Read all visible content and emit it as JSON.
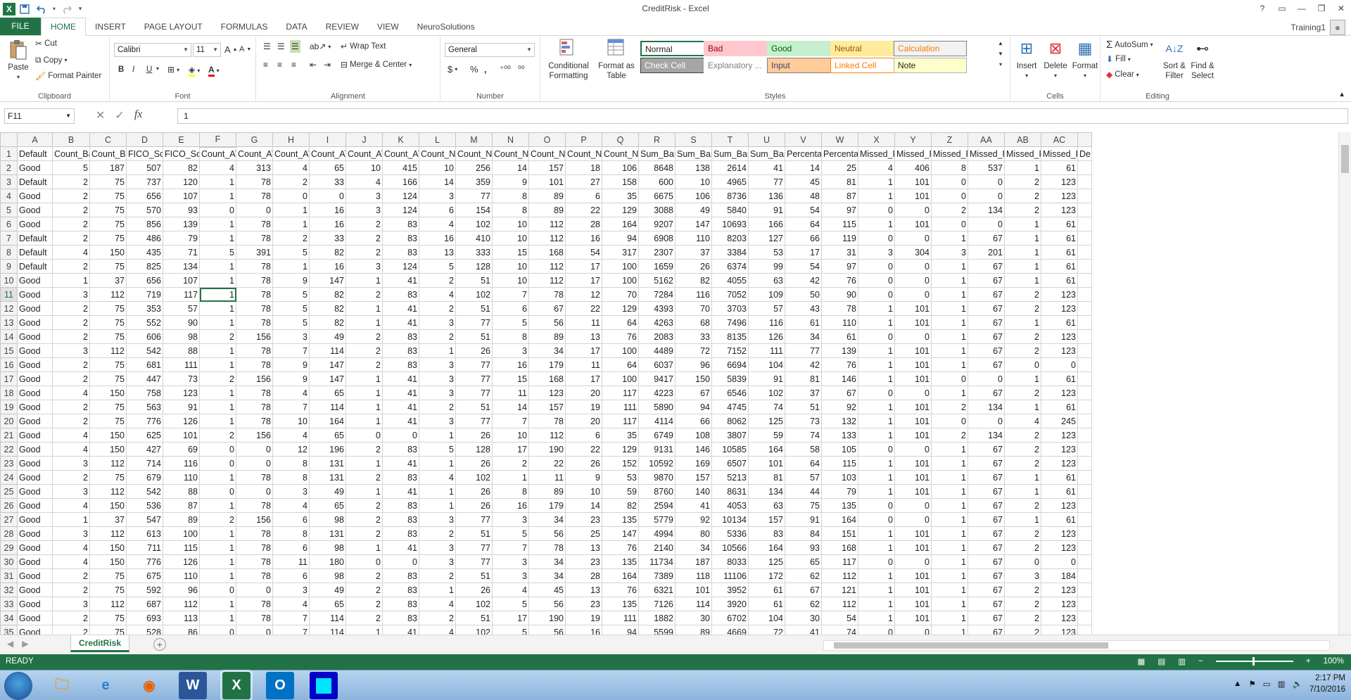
{
  "window": {
    "title": "CreditRisk - Excel",
    "help": "?",
    "restore_ribbon": "▭",
    "minimize": "—",
    "maximize": "❐",
    "close": "✕"
  },
  "qat": {
    "excel_logo": "X",
    "save_icon": "save-icon",
    "undo_icon": "undo-icon",
    "redo_icon": "redo-icon",
    "customize": "▾"
  },
  "tabs": [
    "FILE",
    "HOME",
    "INSERT",
    "PAGE LAYOUT",
    "FORMULAS",
    "DATA",
    "REVIEW",
    "VIEW",
    "NeuroSolutions"
  ],
  "user": {
    "name": "Training1"
  },
  "ribbon": {
    "clipboard": {
      "label": "Clipboard",
      "paste": "Paste",
      "cut": "Cut",
      "copy": "Copy",
      "format_painter": "Format Painter"
    },
    "font": {
      "label": "Font",
      "font_name": "Calibri",
      "font_size": "11",
      "bold": "B",
      "italic": "I",
      "underline": "U",
      "grow": "A",
      "shrink": "A"
    },
    "alignment": {
      "label": "Alignment",
      "wrap_text": "Wrap Text",
      "merge_center": "Merge & Center"
    },
    "number": {
      "label": "Number",
      "format": "General",
      "currency": "$",
      "percent": "%",
      "comma": ","
    },
    "styles": {
      "label": "Styles",
      "conditional_formatting": "Conditional\nFormatting",
      "format_as_table": "Format as\nTable",
      "cells": [
        {
          "text": "Normal",
          "bg": "#ffffff",
          "fg": "#222222",
          "border": "#217346"
        },
        {
          "text": "Bad",
          "bg": "#ffc7ce",
          "fg": "#9c0006",
          "border": "#ffc7ce"
        },
        {
          "text": "Good",
          "bg": "#c6efce",
          "fg": "#006100",
          "border": "#c6efce"
        },
        {
          "text": "Neutral",
          "bg": "#ffeb9c",
          "fg": "#9c5700",
          "border": "#ffeb9c"
        },
        {
          "text": "Calculation",
          "bg": "#f2f2f2",
          "fg": "#fa7d00",
          "border": "#7f7f7f"
        },
        {
          "text": "Check Cell",
          "bg": "#a5a5a5",
          "fg": "#ffffff",
          "border": "#3f3f3f"
        },
        {
          "text": "Explanatory ...",
          "bg": "#ffffff",
          "fg": "#7f7f7f",
          "border": "#ffffff"
        },
        {
          "text": "Input",
          "bg": "#ffcc99",
          "fg": "#3f3f76",
          "border": "#7f7f7f"
        },
        {
          "text": "Linked Cell",
          "bg": "#ffffff",
          "fg": "#fa7d00",
          "border": "#ff8001"
        },
        {
          "text": "Note",
          "bg": "#ffffcc",
          "fg": "#222222",
          "border": "#b2b2b2"
        }
      ]
    },
    "cells": {
      "label": "Cells",
      "insert": "Insert",
      "delete": "Delete",
      "format": "Format"
    },
    "editing": {
      "label": "Editing",
      "autosum": "AutoSum",
      "fill": "Fill",
      "clear": "Clear",
      "sort_filter": "Sort &\nFilter",
      "find_select": "Find &\nSelect"
    }
  },
  "formula_bar": {
    "name_box": "F11",
    "fx": "fx",
    "value": "1",
    "cancel": "✕",
    "enter": "✓"
  },
  "grid": {
    "col_letters": [
      "A",
      "B",
      "C",
      "D",
      "E",
      "F",
      "G",
      "H",
      "I",
      "J",
      "K",
      "L",
      "M",
      "N",
      "O",
      "P",
      "Q",
      "R",
      "S",
      "T",
      "U",
      "V",
      "W",
      "X",
      "Y",
      "Z",
      "AA",
      "AB",
      "AC"
    ],
    "header_row": [
      "Default",
      "Count_Ba",
      "Count_Ba",
      "FICO_Scor",
      "FICO_Scor",
      "Count_AT",
      "Count_AT",
      "Count_AT",
      "Count_AT",
      "Count_AT",
      "Count_AT",
      "Count_Ne",
      "Count_Ne",
      "Count_Ne",
      "Count_Ne",
      "Count_Ne",
      "Count_Ne",
      "Sum_Bank",
      "Sum_Bank",
      "Sum_Bank",
      "Sum_Bank",
      "Percentag",
      "Percentag",
      "Missed_P",
      "Missed_P",
      "Missed_P",
      "Missed_P",
      "Missed_P",
      "Missed_P"
    ],
    "last_col_fragment": "De",
    "rows": [
      [
        "Good",
        5,
        187,
        507,
        82,
        4,
        313,
        4,
        65,
        10,
        415,
        10,
        256,
        14,
        157,
        18,
        106,
        8648,
        138,
        2614,
        41,
        14,
        25,
        4,
        406,
        8,
        537,
        1,
        61
      ],
      [
        "Default",
        2,
        75,
        737,
        120,
        1,
        78,
        2,
        33,
        4,
        166,
        14,
        359,
        9,
        101,
        27,
        158,
        600,
        10,
        4965,
        77,
        45,
        81,
        1,
        101,
        0,
        0,
        2,
        123
      ],
      [
        "Good",
        2,
        75,
        656,
        107,
        1,
        78,
        0,
        0,
        3,
        124,
        3,
        77,
        8,
        89,
        6,
        35,
        6675,
        106,
        8736,
        136,
        48,
        87,
        1,
        101,
        0,
        0,
        2,
        123
      ],
      [
        "Good",
        2,
        75,
        570,
        93,
        0,
        0,
        1,
        16,
        3,
        124,
        6,
        154,
        8,
        89,
        22,
        129,
        3088,
        49,
        5840,
        91,
        54,
        97,
        0,
        0,
        2,
        134,
        2,
        123
      ],
      [
        "Good",
        2,
        75,
        856,
        139,
        1,
        78,
        1,
        16,
        2,
        83,
        4,
        102,
        10,
        112,
        28,
        164,
        9207,
        147,
        10693,
        166,
        64,
        115,
        1,
        101,
        0,
        0,
        1,
        61
      ],
      [
        "Default",
        2,
        75,
        486,
        79,
        1,
        78,
        2,
        33,
        2,
        83,
        16,
        410,
        10,
        112,
        16,
        94,
        6908,
        110,
        8203,
        127,
        66,
        119,
        0,
        0,
        1,
        67,
        1,
        61
      ],
      [
        "Default",
        4,
        150,
        435,
        71,
        5,
        391,
        5,
        82,
        2,
        83,
        13,
        333,
        15,
        168,
        54,
        317,
        2307,
        37,
        3384,
        53,
        17,
        31,
        3,
        304,
        3,
        201,
        1,
        61
      ],
      [
        "Default",
        2,
        75,
        825,
        134,
        1,
        78,
        1,
        16,
        3,
        124,
        5,
        128,
        10,
        112,
        17,
        100,
        1659,
        26,
        6374,
        99,
        54,
        97,
        0,
        0,
        1,
        67,
        1,
        61
      ],
      [
        "Good",
        1,
        37,
        656,
        107,
        1,
        78,
        9,
        147,
        1,
        41,
        2,
        51,
        10,
        112,
        17,
        100,
        5162,
        82,
        4055,
        63,
        42,
        76,
        0,
        0,
        1,
        67,
        1,
        61
      ],
      [
        "Good",
        3,
        112,
        719,
        117,
        1,
        78,
        5,
        82,
        2,
        83,
        4,
        102,
        7,
        78,
        12,
        70,
        7284,
        116,
        7052,
        109,
        50,
        90,
        0,
        0,
        1,
        67,
        2,
        123
      ],
      [
        "Good",
        2,
        75,
        353,
        57,
        1,
        78,
        5,
        82,
        1,
        41,
        2,
        51,
        6,
        67,
        22,
        129,
        4393,
        70,
        3703,
        57,
        43,
        78,
        1,
        101,
        1,
        67,
        2,
        123
      ],
      [
        "Good",
        2,
        75,
        552,
        90,
        1,
        78,
        5,
        82,
        1,
        41,
        3,
        77,
        5,
        56,
        11,
        64,
        4263,
        68,
        7496,
        116,
        61,
        110,
        1,
        101,
        1,
        67,
        1,
        61
      ],
      [
        "Good",
        2,
        75,
        606,
        98,
        2,
        156,
        3,
        49,
        2,
        83,
        2,
        51,
        8,
        89,
        13,
        76,
        2083,
        33,
        8135,
        126,
        34,
        61,
        0,
        0,
        1,
        67,
        2,
        123
      ],
      [
        "Good",
        3,
        112,
        542,
        88,
        1,
        78,
        7,
        114,
        2,
        83,
        1,
        26,
        3,
        34,
        17,
        100,
        4489,
        72,
        7152,
        111,
        77,
        139,
        1,
        101,
        1,
        67,
        2,
        123
      ],
      [
        "Good",
        2,
        75,
        681,
        111,
        1,
        78,
        9,
        147,
        2,
        83,
        3,
        77,
        16,
        179,
        11,
        64,
        6037,
        96,
        6694,
        104,
        42,
        76,
        1,
        101,
        1,
        67,
        0,
        0
      ],
      [
        "Good",
        2,
        75,
        447,
        73,
        2,
        156,
        9,
        147,
        1,
        41,
        3,
        77,
        15,
        168,
        17,
        100,
        9417,
        150,
        5839,
        91,
        81,
        146,
        1,
        101,
        0,
        0,
        1,
        61
      ],
      [
        "Good",
        4,
        150,
        758,
        123,
        1,
        78,
        4,
        65,
        1,
        41,
        3,
        77,
        11,
        123,
        20,
        117,
        4223,
        67,
        6546,
        102,
        37,
        67,
        0,
        0,
        1,
        67,
        2,
        123
      ],
      [
        "Good",
        2,
        75,
        563,
        91,
        1,
        78,
        7,
        114,
        1,
        41,
        2,
        51,
        14,
        157,
        19,
        111,
        5890,
        94,
        4745,
        74,
        51,
        92,
        1,
        101,
        2,
        134,
        1,
        61
      ],
      [
        "Good",
        2,
        75,
        776,
        126,
        1,
        78,
        10,
        164,
        1,
        41,
        3,
        77,
        7,
        78,
        20,
        117,
        4114,
        66,
        8062,
        125,
        73,
        132,
        1,
        101,
        0,
        0,
        4,
        245
      ],
      [
        "Good",
        4,
        150,
        625,
        101,
        2,
        156,
        4,
        65,
        0,
        0,
        1,
        26,
        10,
        112,
        6,
        35,
        6749,
        108,
        3807,
        59,
        74,
        133,
        1,
        101,
        2,
        134,
        2,
        123
      ],
      [
        "Good",
        4,
        150,
        427,
        69,
        0,
        0,
        12,
        196,
        2,
        83,
        5,
        128,
        17,
        190,
        22,
        129,
        9131,
        146,
        10585,
        164,
        58,
        105,
        0,
        0,
        1,
        67,
        2,
        123
      ],
      [
        "Good",
        3,
        112,
        714,
        116,
        0,
        0,
        8,
        131,
        1,
        41,
        1,
        26,
        2,
        22,
        26,
        152,
        10592,
        169,
        6507,
        101,
        64,
        115,
        1,
        101,
        1,
        67,
        2,
        123
      ],
      [
        "Good",
        2,
        75,
        679,
        110,
        1,
        78,
        8,
        131,
        2,
        83,
        4,
        102,
        1,
        11,
        9,
        53,
        9870,
        157,
        5213,
        81,
        57,
        103,
        1,
        101,
        1,
        67,
        1,
        61
      ],
      [
        "Good",
        3,
        112,
        542,
        88,
        0,
        0,
        3,
        49,
        1,
        41,
        1,
        26,
        8,
        89,
        10,
        59,
        8760,
        140,
        8631,
        134,
        44,
        79,
        1,
        101,
        1,
        67,
        1,
        61
      ],
      [
        "Good",
        4,
        150,
        536,
        87,
        1,
        78,
        4,
        65,
        2,
        83,
        1,
        26,
        16,
        179,
        14,
        82,
        2594,
        41,
        4053,
        63,
        75,
        135,
        0,
        0,
        1,
        67,
        2,
        123
      ],
      [
        "Good",
        1,
        37,
        547,
        89,
        2,
        156,
        6,
        98,
        2,
        83,
        3,
        77,
        3,
        34,
        23,
        135,
        5779,
        92,
        10134,
        157,
        91,
        164,
        0,
        0,
        1,
        67,
        1,
        61
      ],
      [
        "Good",
        3,
        112,
        613,
        100,
        1,
        78,
        8,
        131,
        2,
        83,
        2,
        51,
        5,
        56,
        25,
        147,
        4994,
        80,
        5336,
        83,
        84,
        151,
        1,
        101,
        1,
        67,
        2,
        123
      ],
      [
        "Good",
        4,
        150,
        711,
        115,
        1,
        78,
        6,
        98,
        1,
        41,
        3,
        77,
        7,
        78,
        13,
        76,
        2140,
        34,
        10566,
        164,
        93,
        168,
        1,
        101,
        1,
        67,
        2,
        123
      ],
      [
        "Good",
        4,
        150,
        776,
        126,
        1,
        78,
        11,
        180,
        0,
        0,
        3,
        77,
        3,
        34,
        23,
        135,
        11734,
        187,
        8033,
        125,
        65,
        117,
        0,
        0,
        1,
        67,
        0,
        0
      ],
      [
        "Good",
        2,
        75,
        675,
        110,
        1,
        78,
        6,
        98,
        2,
        83,
        2,
        51,
        3,
        34,
        28,
        164,
        7389,
        118,
        11106,
        172,
        62,
        112,
        1,
        101,
        1,
        67,
        3,
        184
      ],
      [
        "Good",
        2,
        75,
        592,
        96,
        0,
        0,
        3,
        49,
        2,
        83,
        1,
        26,
        4,
        45,
        13,
        76,
        6321,
        101,
        3952,
        61,
        67,
        121,
        1,
        101,
        1,
        67,
        2,
        123
      ],
      [
        "Good",
        3,
        112,
        687,
        112,
        1,
        78,
        4,
        65,
        2,
        83,
        4,
        102,
        5,
        56,
        23,
        135,
        7126,
        114,
        3920,
        61,
        62,
        112,
        1,
        101,
        1,
        67,
        2,
        123
      ],
      [
        "Good",
        2,
        75,
        693,
        113,
        1,
        78,
        7,
        114,
        2,
        83,
        2,
        51,
        17,
        190,
        19,
        111,
        1882,
        30,
        6702,
        104,
        30,
        54,
        1,
        101,
        1,
        67,
        2,
        123
      ],
      [
        "Good",
        2,
        75,
        528,
        86,
        0,
        0,
        7,
        114,
        1,
        41,
        4,
        102,
        5,
        56,
        16,
        94,
        5599,
        89,
        4669,
        72,
        41,
        74,
        0,
        0,
        1,
        67,
        2,
        123
      ]
    ]
  },
  "sheet": {
    "tab": "CreditRisk",
    "add": "+"
  },
  "status": {
    "ready": "READY",
    "zoom": "100%",
    "zoom_minus": "−",
    "zoom_plus": "+"
  },
  "taskbar": {
    "time": "2:17 PM",
    "date": "7/10/2016"
  }
}
